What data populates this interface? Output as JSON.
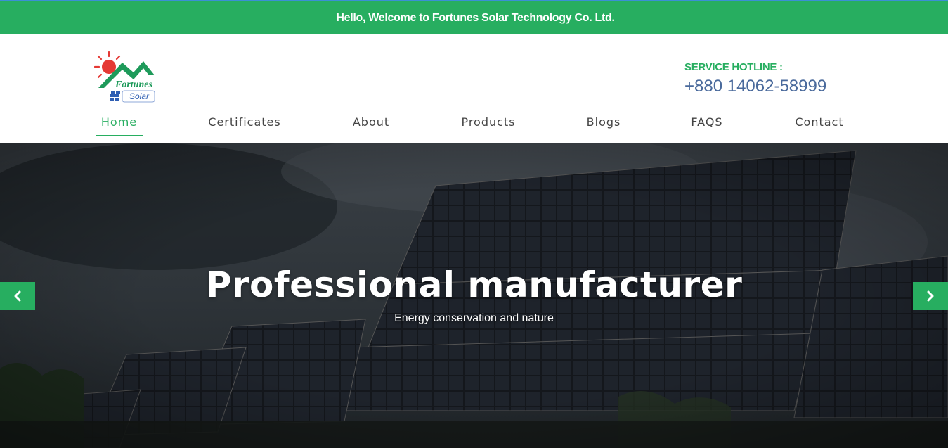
{
  "topbar": {
    "welcome_text": "Hello, Welcome to Fortunes Solar Technology Co. Ltd."
  },
  "logo": {
    "line1": "Fortunes",
    "line2": "Solar"
  },
  "hotline": {
    "label": "SERVICE HOTLINE :",
    "number": "+880 14062-58999"
  },
  "nav": {
    "items": [
      {
        "label": "Home",
        "active": true
      },
      {
        "label": "Certificates"
      },
      {
        "label": "About"
      },
      {
        "label": "Products"
      },
      {
        "label": "Blogs"
      },
      {
        "label": "FAQS"
      },
      {
        "label": "Contact"
      }
    ]
  },
  "hero": {
    "title": "Professional manufacturer",
    "subtitle": "Energy conservation and nature",
    "prev_icon": "chevron-left-icon",
    "next_icon": "chevron-right-icon"
  },
  "colors": {
    "brand_green": "#27ae60",
    "hotline_blue": "#4a6a9c",
    "top_border": "#3b8fd6"
  }
}
